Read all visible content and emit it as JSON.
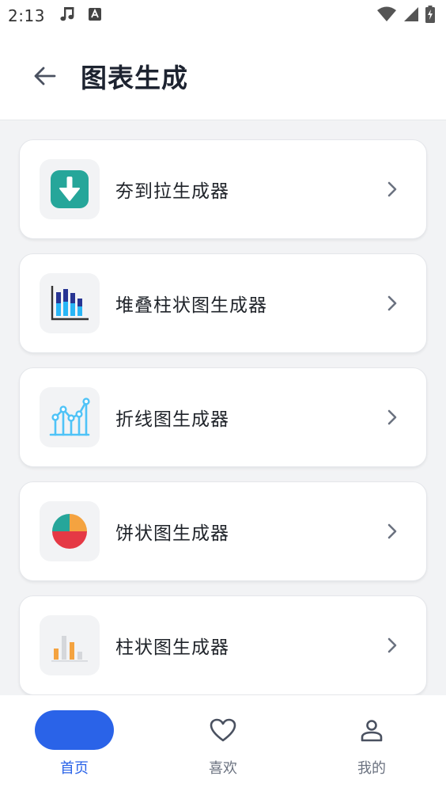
{
  "status_bar": {
    "time": "2:13",
    "icons": [
      "music-note-icon",
      "keyboard-a-icon",
      "wifi-icon",
      "signal-icon",
      "battery-charging-icon"
    ]
  },
  "app_bar": {
    "title": "图表生成",
    "back_icon": "arrow-left-icon"
  },
  "generators": [
    {
      "label": "夯到拉生成器",
      "icon": "download-arrow-icon",
      "accent": "#26a69a"
    },
    {
      "label": "堆叠柱状图生成器",
      "icon": "stacked-bar-chart-icon",
      "accent": "#283593"
    },
    {
      "label": "折线图生成器",
      "icon": "line-chart-icon",
      "accent": "#4fc3f7"
    },
    {
      "label": "饼状图生成器",
      "icon": "pie-chart-icon",
      "accent": "#e53945"
    },
    {
      "label": "柱状图生成器",
      "icon": "bar-chart-icon",
      "accent": "#f4a340"
    }
  ],
  "bottom_nav": {
    "items": [
      {
        "label": "首页",
        "icon": "home-icon",
        "active": true
      },
      {
        "label": "喜欢",
        "icon": "heart-icon",
        "active": false
      },
      {
        "label": "我的",
        "icon": "user-icon",
        "active": false
      }
    ]
  },
  "colors": {
    "primary": "#2a63e8",
    "background": "#f2f3f5",
    "card": "#ffffff"
  }
}
